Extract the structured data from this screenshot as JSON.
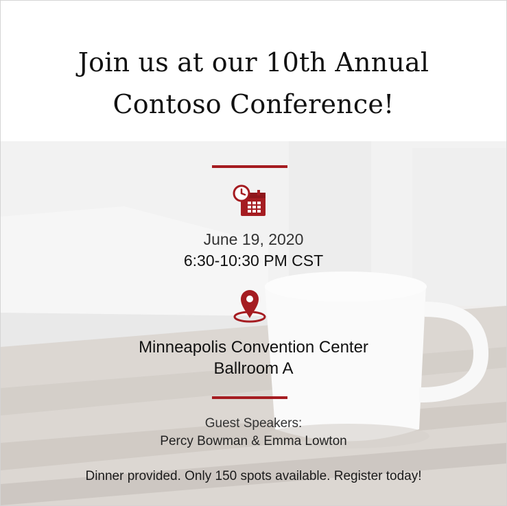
{
  "header": {
    "title_line1": "Join us at our 10th Annual",
    "title_line2": "Contoso Conference!"
  },
  "event": {
    "date": "June 19, 2020",
    "time": "6:30-10:30 PM CST",
    "venue": "Minneapolis Convention Center",
    "room": "Ballroom A"
  },
  "speakers": {
    "label": "Guest Speakers:",
    "names": "Percy Bowman & Emma Lowton"
  },
  "footer": {
    "note": "Dinner provided. Only 150 spots available. Register today!"
  },
  "icons": {
    "schedule": "calendar-clock-icon",
    "location": "location-pin-icon"
  },
  "colors": {
    "accent": "#a51c21",
    "text": "#111111",
    "background_wash": "#e8e6e4"
  }
}
